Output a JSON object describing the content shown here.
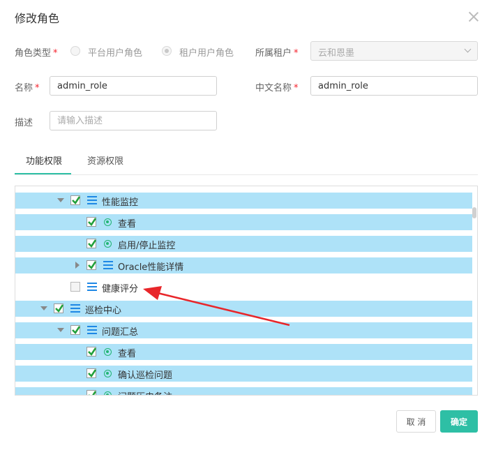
{
  "dialog": {
    "title": "修改角色",
    "close_label": "×"
  },
  "form": {
    "role_type_label": "角色类型",
    "required_mark": "*",
    "radio_platform": "平台用户角色",
    "radio_tenant": "租户用户角色",
    "tenant_label": "所属租户",
    "tenant_value": "云和恩墨",
    "name_label": "名称",
    "name_value": "admin_role",
    "cn_name_label": "中文名称",
    "cn_name_value": "admin_role",
    "desc_label": "描述",
    "desc_placeholder": "请输入描述"
  },
  "tabs": [
    {
      "label": "功能权限",
      "active": true
    },
    {
      "label": "资源权限",
      "active": false
    }
  ],
  "tree": {
    "nodes": [
      {
        "label": "性能监控",
        "checked": true,
        "icon": "menu-icon",
        "caret": "down",
        "highlighted": true
      },
      {
        "label": "查看",
        "checked": true,
        "icon": "dot-icon",
        "caret": "none",
        "highlighted": true
      },
      {
        "label": "启用/停止监控",
        "checked": true,
        "icon": "dot-icon",
        "caret": "none",
        "highlighted": true
      },
      {
        "label": "Oracle性能详情",
        "checked": true,
        "icon": "menu-icon",
        "caret": "right",
        "highlighted": true
      },
      {
        "label": "健康评分",
        "checked": false,
        "icon": "menu-icon",
        "caret": "none",
        "highlighted": false
      },
      {
        "label": "巡检中心",
        "checked": true,
        "icon": "menu-icon",
        "caret": "down",
        "highlighted": true
      },
      {
        "label": "问题汇总",
        "checked": true,
        "icon": "menu-icon",
        "caret": "down",
        "highlighted": true
      },
      {
        "label": "查看",
        "checked": true,
        "icon": "dot-icon",
        "caret": "none",
        "highlighted": true
      },
      {
        "label": "确认巡检问题",
        "checked": true,
        "icon": "dot-icon",
        "caret": "none",
        "highlighted": true
      },
      {
        "label": "问题历史备注",
        "checked": true,
        "icon": "dot-icon",
        "caret": "none",
        "highlighted": true
      }
    ]
  },
  "annotation": {
    "arrow_color": "#e8262a"
  },
  "footer": {
    "cancel_label": "取 消",
    "ok_label": "确定"
  },
  "colors": {
    "accent": "#2ebfa5",
    "row_highlight": "#aee2f8",
    "icon_blue": "#1e88e5",
    "icon_green": "#22b573",
    "required": "#f5222d"
  }
}
